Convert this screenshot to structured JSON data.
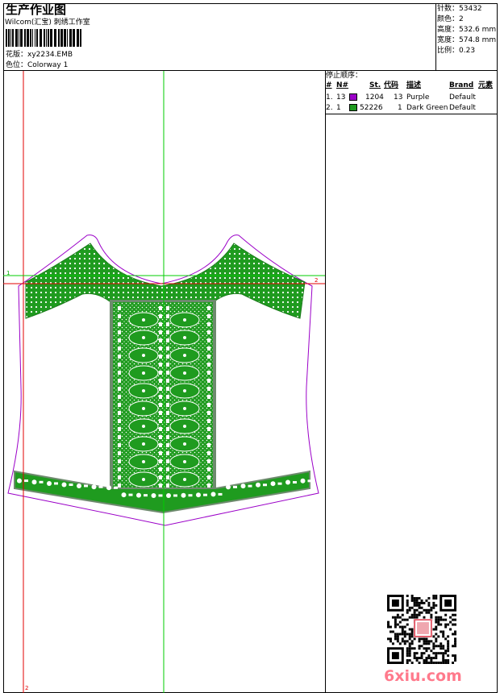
{
  "header": {
    "title": "生产作业图",
    "subtitle": "Wilcom(汇宝) 刺绣工作室",
    "design_label": "花版：",
    "design_value": "xy2234.EMB",
    "colorway_label": "色位：",
    "colorway_value": "Colorway 1"
  },
  "meta": [
    {
      "label": "针数：",
      "value": "53432"
    },
    {
      "label": "颜色：",
      "value": "2"
    },
    {
      "label": "高度：",
      "value": "532.6 mm"
    },
    {
      "label": "宽度：",
      "value": "574.8 mm"
    },
    {
      "label": "比例：",
      "value": "0.23"
    }
  ],
  "stop_sequence": {
    "title": "停止顺序：",
    "headers": [
      "#",
      "N#",
      "St.",
      "代码",
      "描述",
      "Brand",
      "元素"
    ],
    "rows": [
      {
        "num": "1.",
        "n": "13",
        "color": "#9b00c8",
        "stitches": "1204",
        "code": "13",
        "desc": "Purple",
        "brand": "Default"
      },
      {
        "num": "2.",
        "n": "1",
        "color": "#1f9b1f",
        "stitches": "52226",
        "code": "1",
        "desc": "Dark Green",
        "brand": "Default"
      }
    ]
  },
  "canvas_markers": {
    "left_top": "1",
    "right_top": "2",
    "bottom_left": "2"
  },
  "watermark": "6xiu.com",
  "colors": {
    "outline": "#9b00c8",
    "fill": "#1f9b1f",
    "guide_red": "#e00000",
    "guide_green": "#00cc00"
  }
}
